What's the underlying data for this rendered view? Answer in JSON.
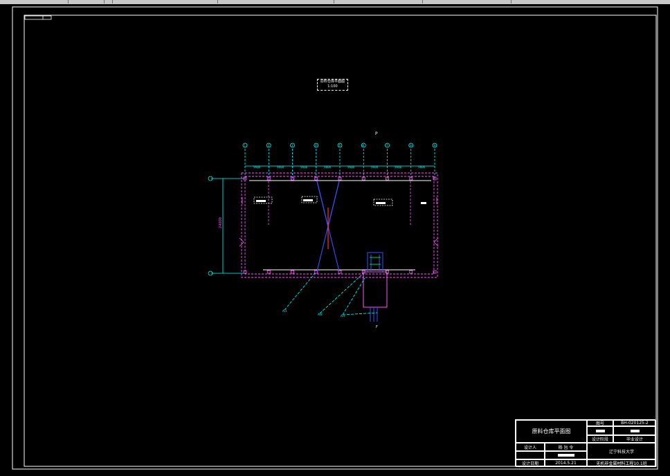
{
  "drawing": {
    "plan_title": "原料仓库平面图",
    "plan_scale": "1:100"
  },
  "title_block": {
    "drawing_name": "原料仓库平面图",
    "drawing_no_label": "图号",
    "drawing_no_value": "BH-020125-2",
    "design_stage_label": "设计阶段",
    "design_stage_value": "毕业设计",
    "designer_label": "设计人",
    "designer_value": "杨 旨 令",
    "school": "辽宁科技大学",
    "date_label": "设计日期",
    "date_value": "2014.5.21",
    "class_value": "无机非金属材料工程10.1班"
  },
  "axis_labels": [
    "1",
    "2",
    "3",
    "4",
    "5",
    "6",
    "7",
    "8",
    "9"
  ],
  "colors": {
    "frame": "#ffffff",
    "wall": "#ff55ff",
    "axis": "#00ffff",
    "crane": "#3355ff",
    "rail": "#ff3333"
  }
}
